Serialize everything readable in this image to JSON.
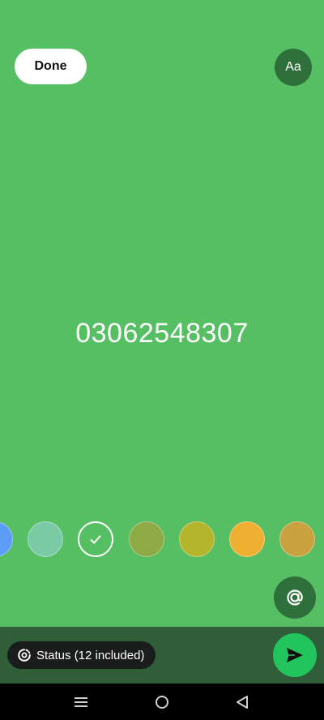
{
  "header": {
    "done_label": "Done",
    "font_button_label": "Aa"
  },
  "status": {
    "text": "03062548307"
  },
  "palette": {
    "colors": [
      "#5b9cf6",
      "#7bcaa6",
      "#56bf64",
      "#8eaa45",
      "#b4b52a",
      "#efb032",
      "#c9a13f"
    ],
    "selected_index": 2
  },
  "footer": {
    "audience_label": "Status (12 included)"
  },
  "icons": {
    "mention": "at-sign-icon",
    "send": "send-icon",
    "audience": "status-ring-icon",
    "nav_recents": "menu-lines-icon",
    "nav_home": "home-circle-icon",
    "nav_back": "back-triangle-icon"
  },
  "colors": {
    "background": "#56bf64",
    "dark_accent": "#2f6f3c",
    "bottom_bar": "#2f5e38",
    "send": "#22c45e"
  }
}
